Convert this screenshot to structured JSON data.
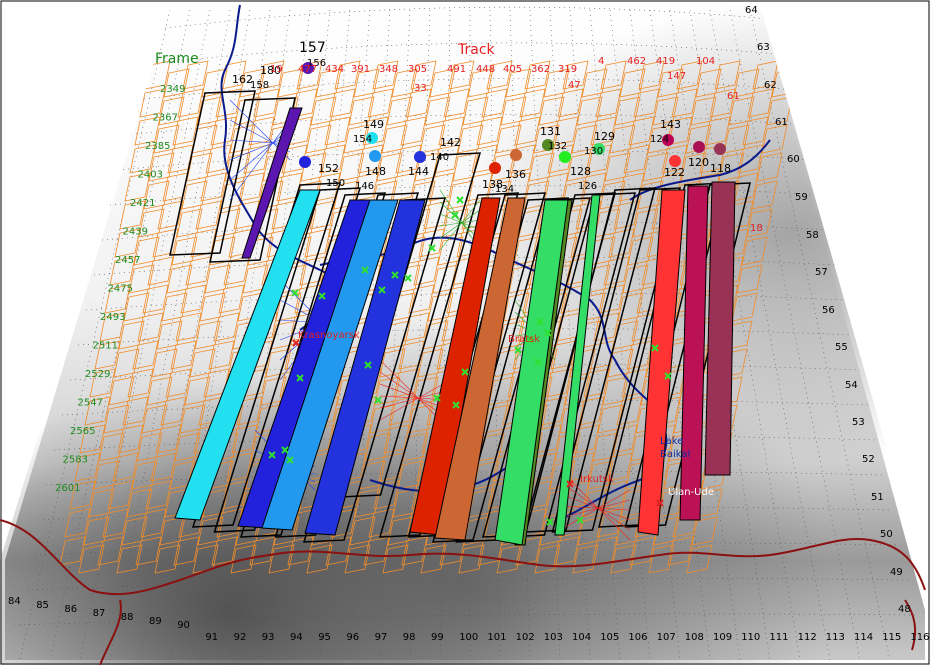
{
  "titles": {
    "frame": "Frame",
    "track": "Track"
  },
  "colors": {
    "frame_label": "#1e8a1e",
    "track_label": "#e82020",
    "grid_orange": "#f08c2a",
    "footprint": "#000000",
    "river": "#0a1a8c",
    "border": "#8b1010",
    "site_green": "#30e030",
    "site_red": "#e02020",
    "coverage_blue": "#2244ee",
    "coverage_red": "#ee2222",
    "coverage_green": "#22aa22"
  },
  "track_labels_top": [
    "19",
    "477",
    "434",
    "391",
    "348",
    "305",
    "491",
    "448",
    "405",
    "362",
    "319",
    "4",
    "462",
    "419",
    "104"
  ],
  "track_labels_second": [
    "33",
    "47",
    "147"
  ],
  "track_labels_side": [
    "61",
    "18"
  ],
  "frame_labels": [
    "2349",
    "2367",
    "2385",
    "2403",
    "2421",
    "2439",
    "2457",
    "2475",
    "2493",
    "2511",
    "2529",
    "2547",
    "2565",
    "2583",
    "2601"
  ],
  "lat_labels": [
    "64",
    "63",
    "62",
    "61",
    "60",
    "59",
    "58",
    "57",
    "56",
    "55",
    "54",
    "53",
    "52",
    "51",
    "50",
    "49",
    "48"
  ],
  "lon_labels": [
    "84",
    "85",
    "86",
    "87",
    "88",
    "89",
    "90",
    "91",
    "92",
    "93",
    "94",
    "95",
    "96",
    "97",
    "98",
    "99",
    "100",
    "101",
    "102",
    "103",
    "104",
    "105",
    "106",
    "107",
    "108",
    "109",
    "110",
    "111",
    "112",
    "113",
    "114",
    "115",
    "116"
  ],
  "orbits": [
    {
      "label": "157",
      "dot": "#5b16b0",
      "stripe": "#5b16b0",
      "sublabel": "156"
    },
    {
      "label": "180",
      "dot": null,
      "stripe": null,
      "sublabel": "158"
    },
    {
      "label": "162",
      "dot": null,
      "stripe": null,
      "sublabel": ""
    },
    {
      "label": "149",
      "dot": "#22e0f0",
      "stripe": "#22e0f0",
      "sublabel": "154"
    },
    {
      "label": "152",
      "dot": "#2222dd",
      "stripe": "#2222dd",
      "sublabel": "150"
    },
    {
      "label": "148",
      "dot": "#2299ee",
      "stripe": "#2299ee",
      "sublabel": "146"
    },
    {
      "label": "144",
      "dot": "#2233dd",
      "stripe": "#2233dd",
      "sublabel": ""
    },
    {
      "label": "142",
      "dot": null,
      "stripe": null,
      "sublabel": "140"
    },
    {
      "label": "138",
      "dot": "#dd2200",
      "stripe": "#dd2200",
      "sublabel": ""
    },
    {
      "label": "136",
      "dot": "#cc6633",
      "stripe": "#cc6633",
      "sublabel": "134"
    },
    {
      "label": "131",
      "dot": "#558822",
      "stripe": "#558822",
      "sublabel": "132"
    },
    {
      "label": "129",
      "dot": "#33dd66",
      "stripe": "#33dd66",
      "sublabel": "130"
    },
    {
      "label": "128",
      "dot": "#22ee22",
      "stripe": "#22ee22",
      "sublabel": "126"
    },
    {
      "label": "143",
      "dot": "#bb0055",
      "stripe": "#ee3333",
      "sublabel": "124"
    },
    {
      "label": "122",
      "dot": "#ff3333",
      "stripe": "#ff3333",
      "sublabel": ""
    },
    {
      "label": "120",
      "dot": "#aa1155",
      "stripe": "#aa1155",
      "sublabel": ""
    },
    {
      "label": "118",
      "dot": "#993355",
      "stripe": "#993355",
      "sublabel": ""
    }
  ],
  "places": {
    "krasnoyarsk": "Krasnoyarsk",
    "irkutsk": "Irkutsk",
    "lake_baikal_1": "Lake",
    "lake_baikal_2": "Baikal",
    "ulan_ude": "Ulan-Ude",
    "bratsk": "Bratsk"
  }
}
